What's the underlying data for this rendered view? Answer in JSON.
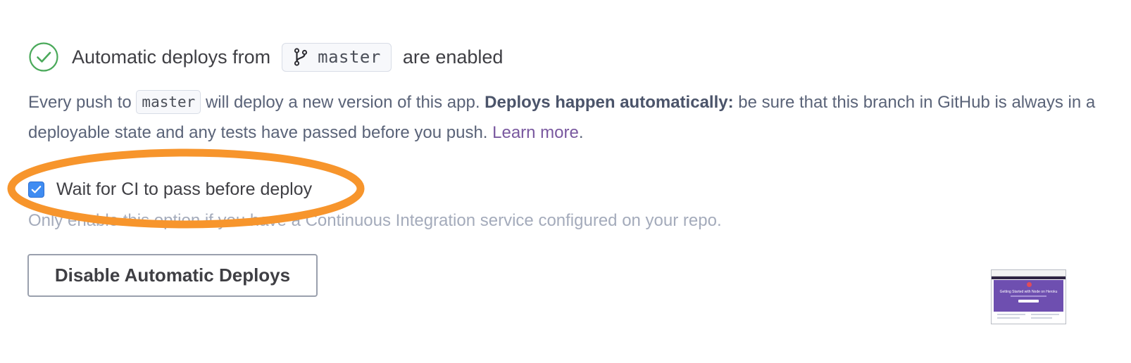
{
  "deploy_status": {
    "icon": "check-circle-icon",
    "status_color": "#4aa95a",
    "prefix": "Automatic deploys from",
    "branch_icon": "git-branch-icon",
    "branch": "master",
    "suffix": "are enabled"
  },
  "description": {
    "part1": "Every push to",
    "branch": "master",
    "part2": "will deploy a new version of this app.",
    "emphasis": "Deploys happen automatically:",
    "part3": "be sure that this branch in GitHub is always in a deployable state and any tests have passed before you push.",
    "link": "Learn more",
    "end": "."
  },
  "ci_option": {
    "label": "Wait for CI to pass before deploy",
    "checked": true,
    "hint": "Only enable this option if you have a Continuous Integration service configured on your repo."
  },
  "actions": {
    "disable_label": "Disable Automatic Deploys"
  },
  "thumbnail": {
    "title": "Getting Started with Node on Heroku"
  },
  "colors": {
    "highlight": "#f7952c",
    "checkbox": "#3f8cf2",
    "link": "#79589f"
  }
}
